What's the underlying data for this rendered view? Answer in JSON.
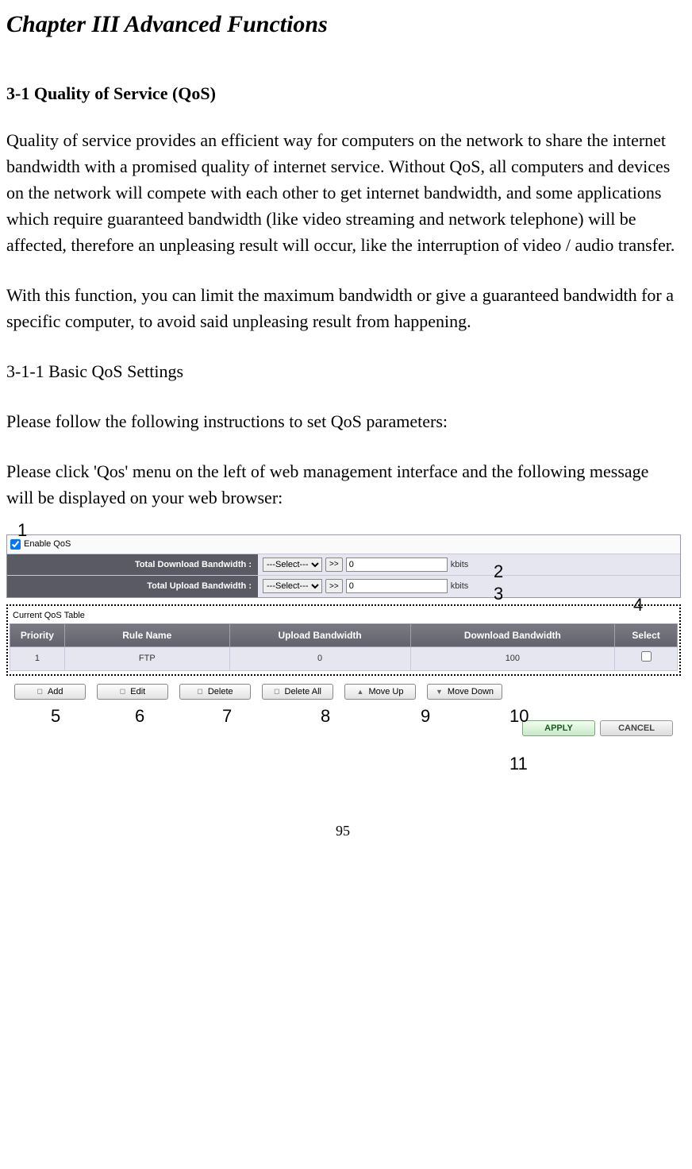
{
  "chapter_title": "Chapter III    Advanced Functions",
  "section_title": "3-1 Quality of Service (QoS)",
  "para1": "Quality of service provides an efficient way for computers on the network to share the internet bandwidth with a promised quality of internet service. Without QoS, all computers and devices on the network will compete with each other to get internet bandwidth, and some applications which require guaranteed bandwidth (like video streaming and network telephone) will be affected, therefore an unpleasing result will occur, like the interruption of video / audio transfer.",
  "para2": "With this function, you can limit the maximum bandwidth or give a guaranteed bandwidth for a specific computer, to avoid said unpleasing result from happening.",
  "subsection_title": "3-1-1 Basic QoS Settings",
  "para3": "Please follow the following instructions to set QoS parameters:",
  "para4": "Please click 'Qos' menu on the left of web management interface and the following message will be displayed on your web browser:",
  "panel": {
    "enable_label": "Enable QoS",
    "dl_label": "Total Download Bandwidth :",
    "ul_label": "Total Upload Bandwidth :",
    "select_placeholder": "---Select---",
    "go_label": ">>",
    "value": "0",
    "unit": "kbits",
    "table_title": "Current QoS Table",
    "headers": {
      "priority": "Priority",
      "name": "Rule Name",
      "upload": "Upload Bandwidth",
      "download": "Download Bandwidth",
      "select": "Select"
    },
    "row": {
      "priority": "1",
      "name": "FTP",
      "upload": "0",
      "download": "100"
    },
    "buttons": {
      "add": "Add",
      "edit": "Edit",
      "delete": "Delete",
      "delete_all": "Delete All",
      "move_up": "Move Up",
      "move_down": "Move Down"
    },
    "apply": "APPLY",
    "cancel": "CANCEL"
  },
  "callouts": {
    "c1": "1",
    "c2": "2",
    "c3": "3",
    "c4": "4",
    "c5": "5",
    "c6": "6",
    "c7": "7",
    "c8": "8",
    "c9": "9",
    "c10": "10",
    "c11": "11"
  },
  "page_number": "95"
}
